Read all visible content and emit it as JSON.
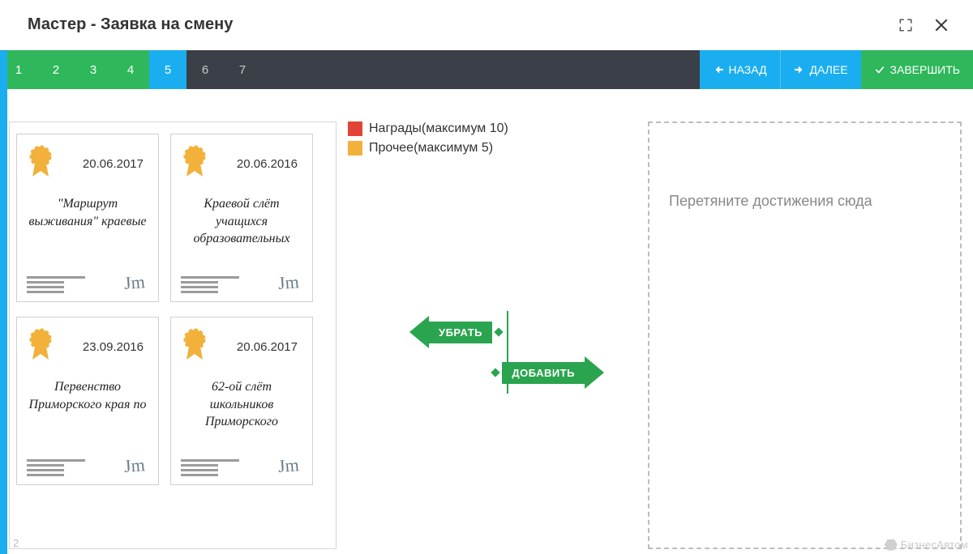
{
  "titlebar": {
    "title": "Мастер - Заявка на смену"
  },
  "steps": [
    {
      "n": "1",
      "state": "completed"
    },
    {
      "n": "2",
      "state": "completed"
    },
    {
      "n": "3",
      "state": "completed"
    },
    {
      "n": "4",
      "state": "completed"
    },
    {
      "n": "5",
      "state": "current"
    },
    {
      "n": "6",
      "state": "future"
    },
    {
      "n": "7",
      "state": "future"
    }
  ],
  "nav": {
    "back": "НАЗАД",
    "next": "ДАЛЕЕ",
    "finish": "ЗАВЕРШИТЬ"
  },
  "legend": [
    {
      "color": "red",
      "label": "Награды(максимум 10)"
    },
    {
      "color": "amber",
      "label": "Прочее(максимум 5)"
    }
  ],
  "arrows": {
    "remove": "УБРАТЬ",
    "add": "ДОБАВИТЬ"
  },
  "dropzone": {
    "text": "Перетяните достижения сюда"
  },
  "certs": [
    {
      "date": "20.06.2017",
      "title": "\"Маршрут выживания\" краевые"
    },
    {
      "date": "20.06.2016",
      "title": "Краевой слёт учащихся образовательных"
    },
    {
      "date": "23.09.2016",
      "title": "Первенство Приморского края по"
    },
    {
      "date": "20.06.2017",
      "title": "62-ой слёт школьников Приморского"
    }
  ],
  "footer": {
    "page": "2",
    "watermark": "БизнесАвтом"
  }
}
